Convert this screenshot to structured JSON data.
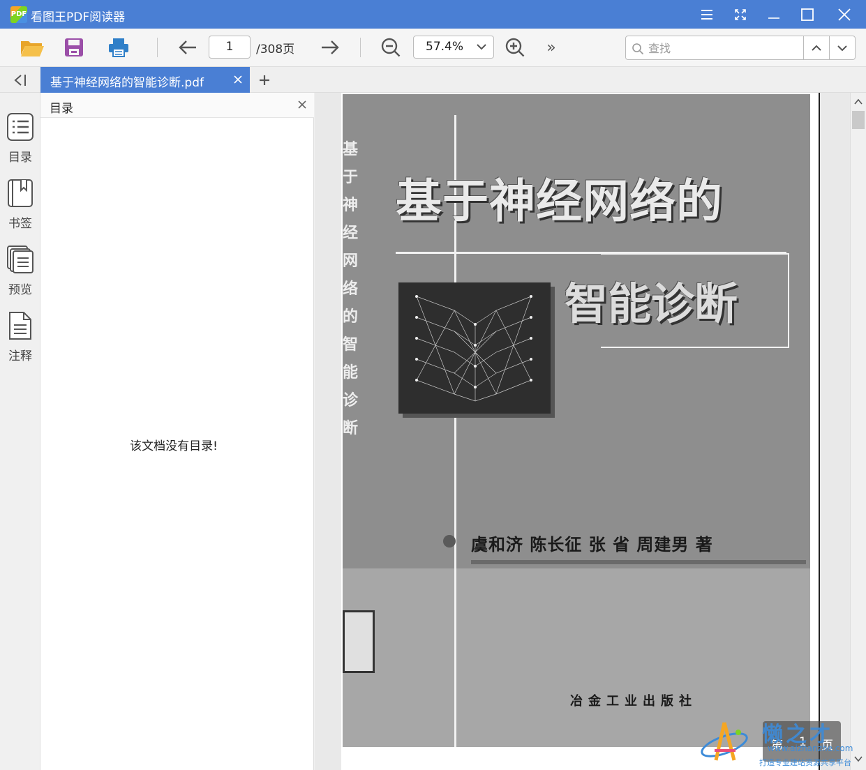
{
  "app": {
    "title": "看图王PDF阅读器",
    "logo_text": "PDF",
    "accent_color": "#4a7fd4"
  },
  "window_controls": [
    "menu-icon",
    "fullscreen-icon",
    "minimize-icon",
    "maximize-icon",
    "close-icon"
  ],
  "toolbar": {
    "open_icon": "folder-open-icon",
    "save_icon": "save-icon",
    "print_icon": "printer-icon",
    "prev_icon": "arrow-left-icon",
    "current_page": "1",
    "total_pages_label": "/308页",
    "next_icon": "arrow-right-icon",
    "zoom_out_icon": "zoom-out-icon",
    "zoom_value": "57.4%",
    "zoom_in_icon": "zoom-in-icon",
    "more_label": "»",
    "search_placeholder": "查找",
    "search_up_icon": "chevron-up-icon",
    "search_down_icon": "chevron-down-icon"
  },
  "tabs": {
    "collapse_label": "<I",
    "items": [
      {
        "label": "基于神经网络的智能诊断.pdf",
        "active": true
      }
    ],
    "add_label": "+"
  },
  "sidebar": {
    "items": [
      {
        "label": "目录",
        "icon": "list-icon"
      },
      {
        "label": "书签",
        "icon": "bookmark-icon"
      },
      {
        "label": "预览",
        "icon": "pages-icon"
      },
      {
        "label": "注释",
        "icon": "note-icon"
      }
    ]
  },
  "outline_panel": {
    "title": "目录",
    "empty_message": "该文档没有目录!"
  },
  "document": {
    "cover_title_line1": "基于神经网络的",
    "cover_title_line2": "智能诊断",
    "cover_authors": "虞和济 陈长征 张 省 周建男 著",
    "cover_publisher": "冶金工业出版社",
    "spine_text": "基于神经网络的智能诊断"
  },
  "page_indicator": {
    "prefix": "第",
    "number": "1",
    "suffix": "页"
  },
  "watermark": {
    "brand": "懒之才",
    "url": "www.aizhanzhe.com",
    "slogan": "打造专业建站资源共享平台"
  }
}
